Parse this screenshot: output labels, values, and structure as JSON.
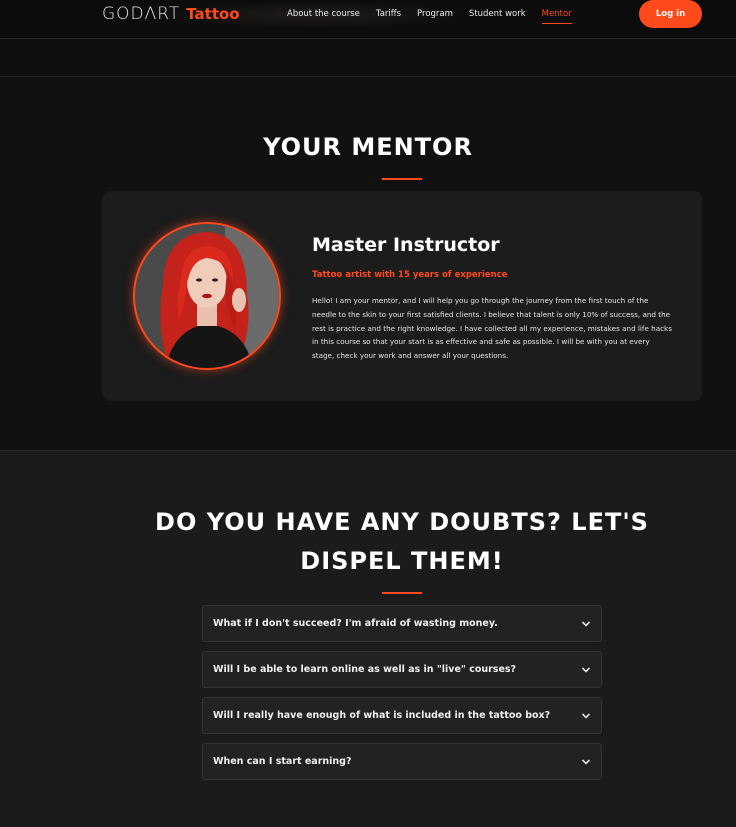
{
  "header": {
    "logo_main": "GODΛRT",
    "logo_accent": "Tattoo",
    "nav": [
      {
        "label": "About the course",
        "active": false
      },
      {
        "label": "Tariffs",
        "active": false
      },
      {
        "label": "Program",
        "active": false
      },
      {
        "label": "Student work",
        "active": false
      },
      {
        "label": "Mentor",
        "active": true
      }
    ],
    "login_label": "Log in"
  },
  "mentor": {
    "section_title": "YOUR MENTOR",
    "name": "Master Instructor",
    "role": "Tattoo artist with 15 years of experience",
    "bio": "Hello! I am your mentor, and I will help you go through the journey from the first touch of the needle to the skin to your first satisfied clients. I believe that talent is only 10% of success, and the rest is practice and the right knowledge. I have collected all my experience, mistakes and life hacks in this course so that your start is as effective and safe as possible. I will be with you at every stage, check your work and answer all your questions."
  },
  "faq": {
    "title": "DO YOU HAVE ANY DOUBTS? LET'S DISPEL THEM!",
    "items": [
      "What if I don't succeed? I'm afraid of wasting money.",
      "Will I be able to learn online as well as in \"live\" courses?",
      "Will I really have enough of what is included in the tattoo box?",
      "When can I start earning?"
    ]
  },
  "colors": {
    "accent": "#ff4a1c",
    "background": "#111111",
    "card": "#1c1c1c"
  }
}
